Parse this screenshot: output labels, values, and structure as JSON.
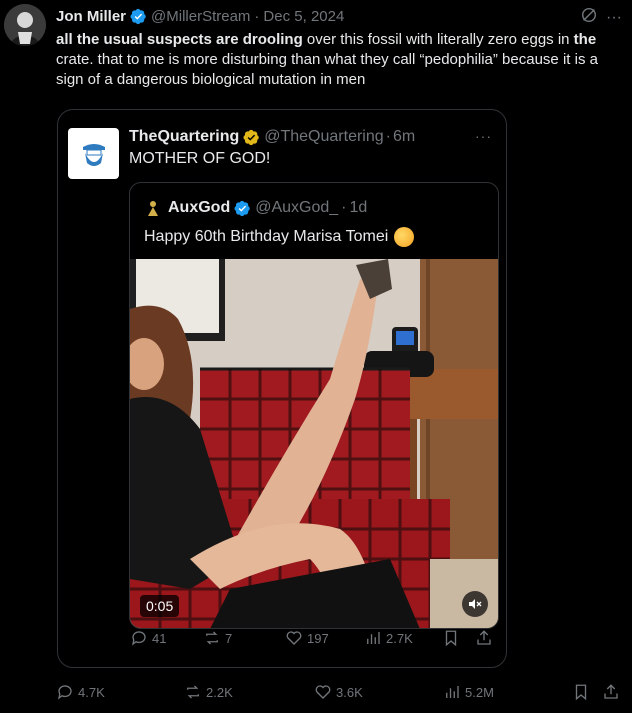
{
  "post": {
    "author_name": "Jon Miller",
    "handle": "@MillerStream",
    "separator": "·",
    "date": "Dec 5, 2024",
    "text_bold_1": "all the usual suspects are drooling",
    "text_1": " over this fossil with literally zero eggs in ",
    "text_bold_2": "the",
    "text_2": " crate. that to me is more disturbing than what they call “pedophilia” because it is a sign of a dangerous biological mutation in men",
    "more_label": "···"
  },
  "quote": {
    "author_name": "TheQuartering",
    "handle": "@TheQuartering",
    "separator": "·",
    "time": "6m",
    "text": "MOTHER OF GOD!",
    "more_label": "···",
    "inner": {
      "author_name": "AuxGod",
      "handle": "@AuxGod_",
      "separator": "·",
      "time": "1d",
      "text": "Happy 60th Birthday Marisa Tomei"
    },
    "video": {
      "duration": "0:05"
    },
    "actions": {
      "replies": "41",
      "reposts": "7",
      "likes": "197",
      "views": "2.7K"
    }
  },
  "actions": {
    "replies": "4.7K",
    "reposts": "2.2K",
    "likes": "3.6K",
    "views": "5.2M"
  },
  "colors": {
    "background": "#000000",
    "text": "#e7e9ea",
    "muted": "#71767b",
    "border": "#2f3336",
    "verified_blue": "#1d9bf0",
    "verified_gold": "#e2b719"
  }
}
